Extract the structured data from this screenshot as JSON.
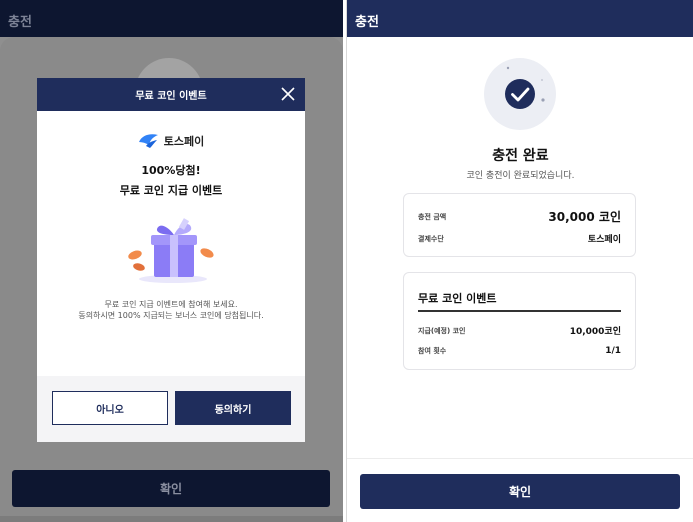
{
  "left": {
    "header_title": "충전",
    "confirm_label": "확인",
    "modal": {
      "title": "무료 코인 이벤트",
      "brand_name": "토스페이",
      "headline_line1": "100%당첨!",
      "headline_line2": "무료 코인 지급 이벤트",
      "desc_line1": "무료 코인 지급 이벤트에 참여해 보세요.",
      "desc_line2": "동의하시면 100% 지급되는 보너스 코인에 당첨됩니다.",
      "no_label": "아니오",
      "yes_label": "동의하기"
    }
  },
  "right": {
    "header_title": "충전",
    "title": "충전 완료",
    "subtitle": "코인 충전이 완료되었습니다.",
    "payment_card": {
      "amount_label": "충전 금액",
      "amount_value": "30,000 코인",
      "method_label": "결제수단",
      "method_value": "토스페이"
    },
    "event_card": {
      "title": "무료 코인 이벤트",
      "granted_label": "지급(예정) 코인",
      "granted_value": "10,000코인",
      "count_label": "참여 횟수",
      "count_value": "1/1"
    },
    "confirm_label": "확인"
  },
  "colors": {
    "navy": "#1f2d5c",
    "dark_navy": "#0d1630",
    "toss_blue": "#3182f6",
    "gift_purple": "#8b7cf6",
    "coin_orange": "#f28b4b"
  },
  "icons": {
    "close": "close-icon",
    "brand": "toss-logo-icon",
    "gift": "gift-icon",
    "check": "check-circle-icon"
  }
}
